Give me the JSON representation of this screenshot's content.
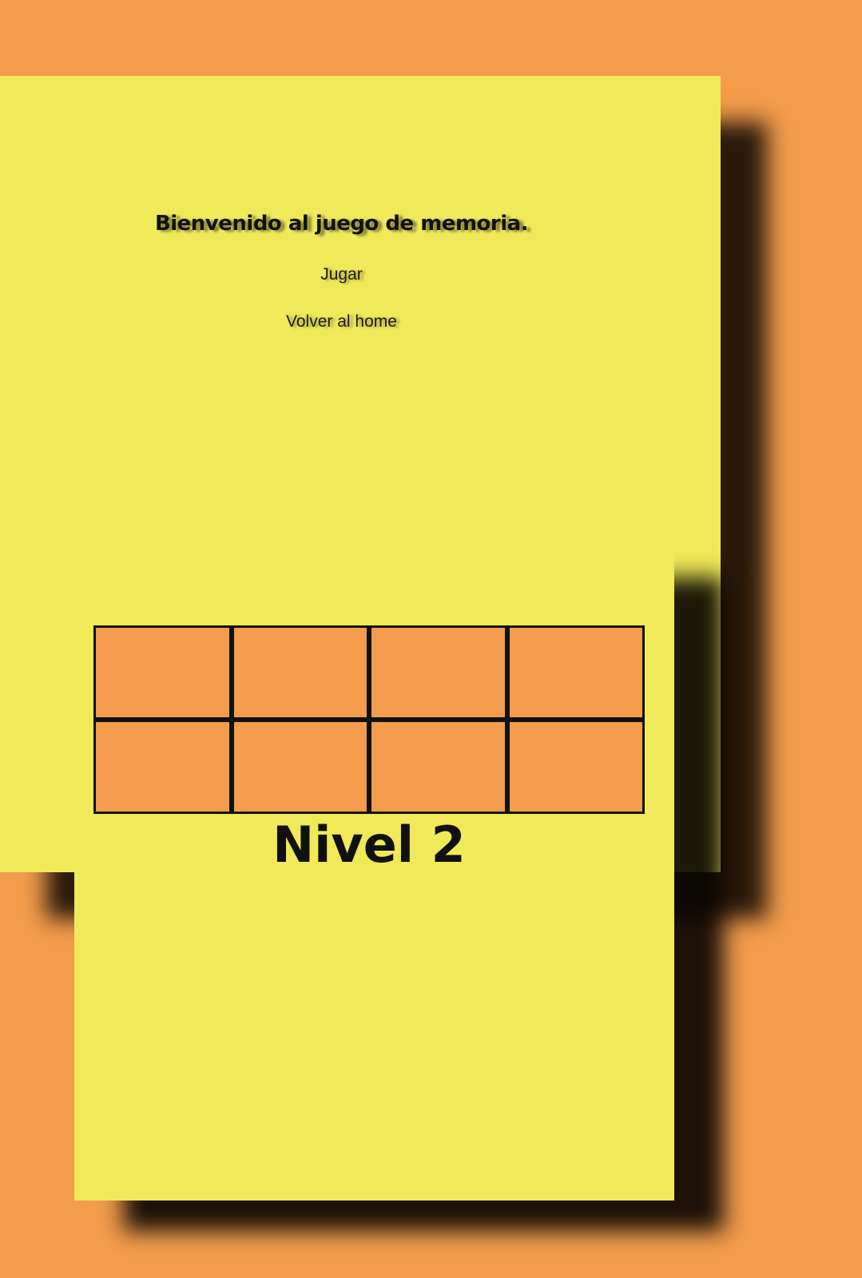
{
  "menu": {
    "title": "Bienvenido al juego de memoria.",
    "play_label": "Jugar",
    "home_label": "Volver al home"
  },
  "board": {
    "rows": 2,
    "columns": 4,
    "cards": [
      {
        "state": "face-down"
      },
      {
        "state": "face-down"
      },
      {
        "state": "face-down"
      },
      {
        "state": "face-down"
      },
      {
        "state": "face-down"
      },
      {
        "state": "face-down"
      },
      {
        "state": "face-down"
      },
      {
        "state": "face-down"
      }
    ]
  },
  "level": {
    "label": "Nivel 2"
  },
  "colors": {
    "background": "#F39C4C",
    "panel": "#F0EA5A",
    "card_back": "#F39C4C",
    "grid_line": "#111111"
  }
}
